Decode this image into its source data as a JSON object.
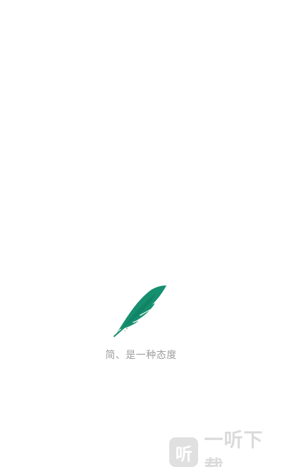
{
  "splash": {
    "logo_icon": "feather-icon",
    "slogan": "简、是一种态度",
    "colors": {
      "feather": "#168f6f",
      "feather_dark": "#0f7458",
      "slogan": "#9e9e9e",
      "background": "#ffffff"
    }
  },
  "watermark": {
    "badge_glyph": "听",
    "text": "一听下载"
  }
}
